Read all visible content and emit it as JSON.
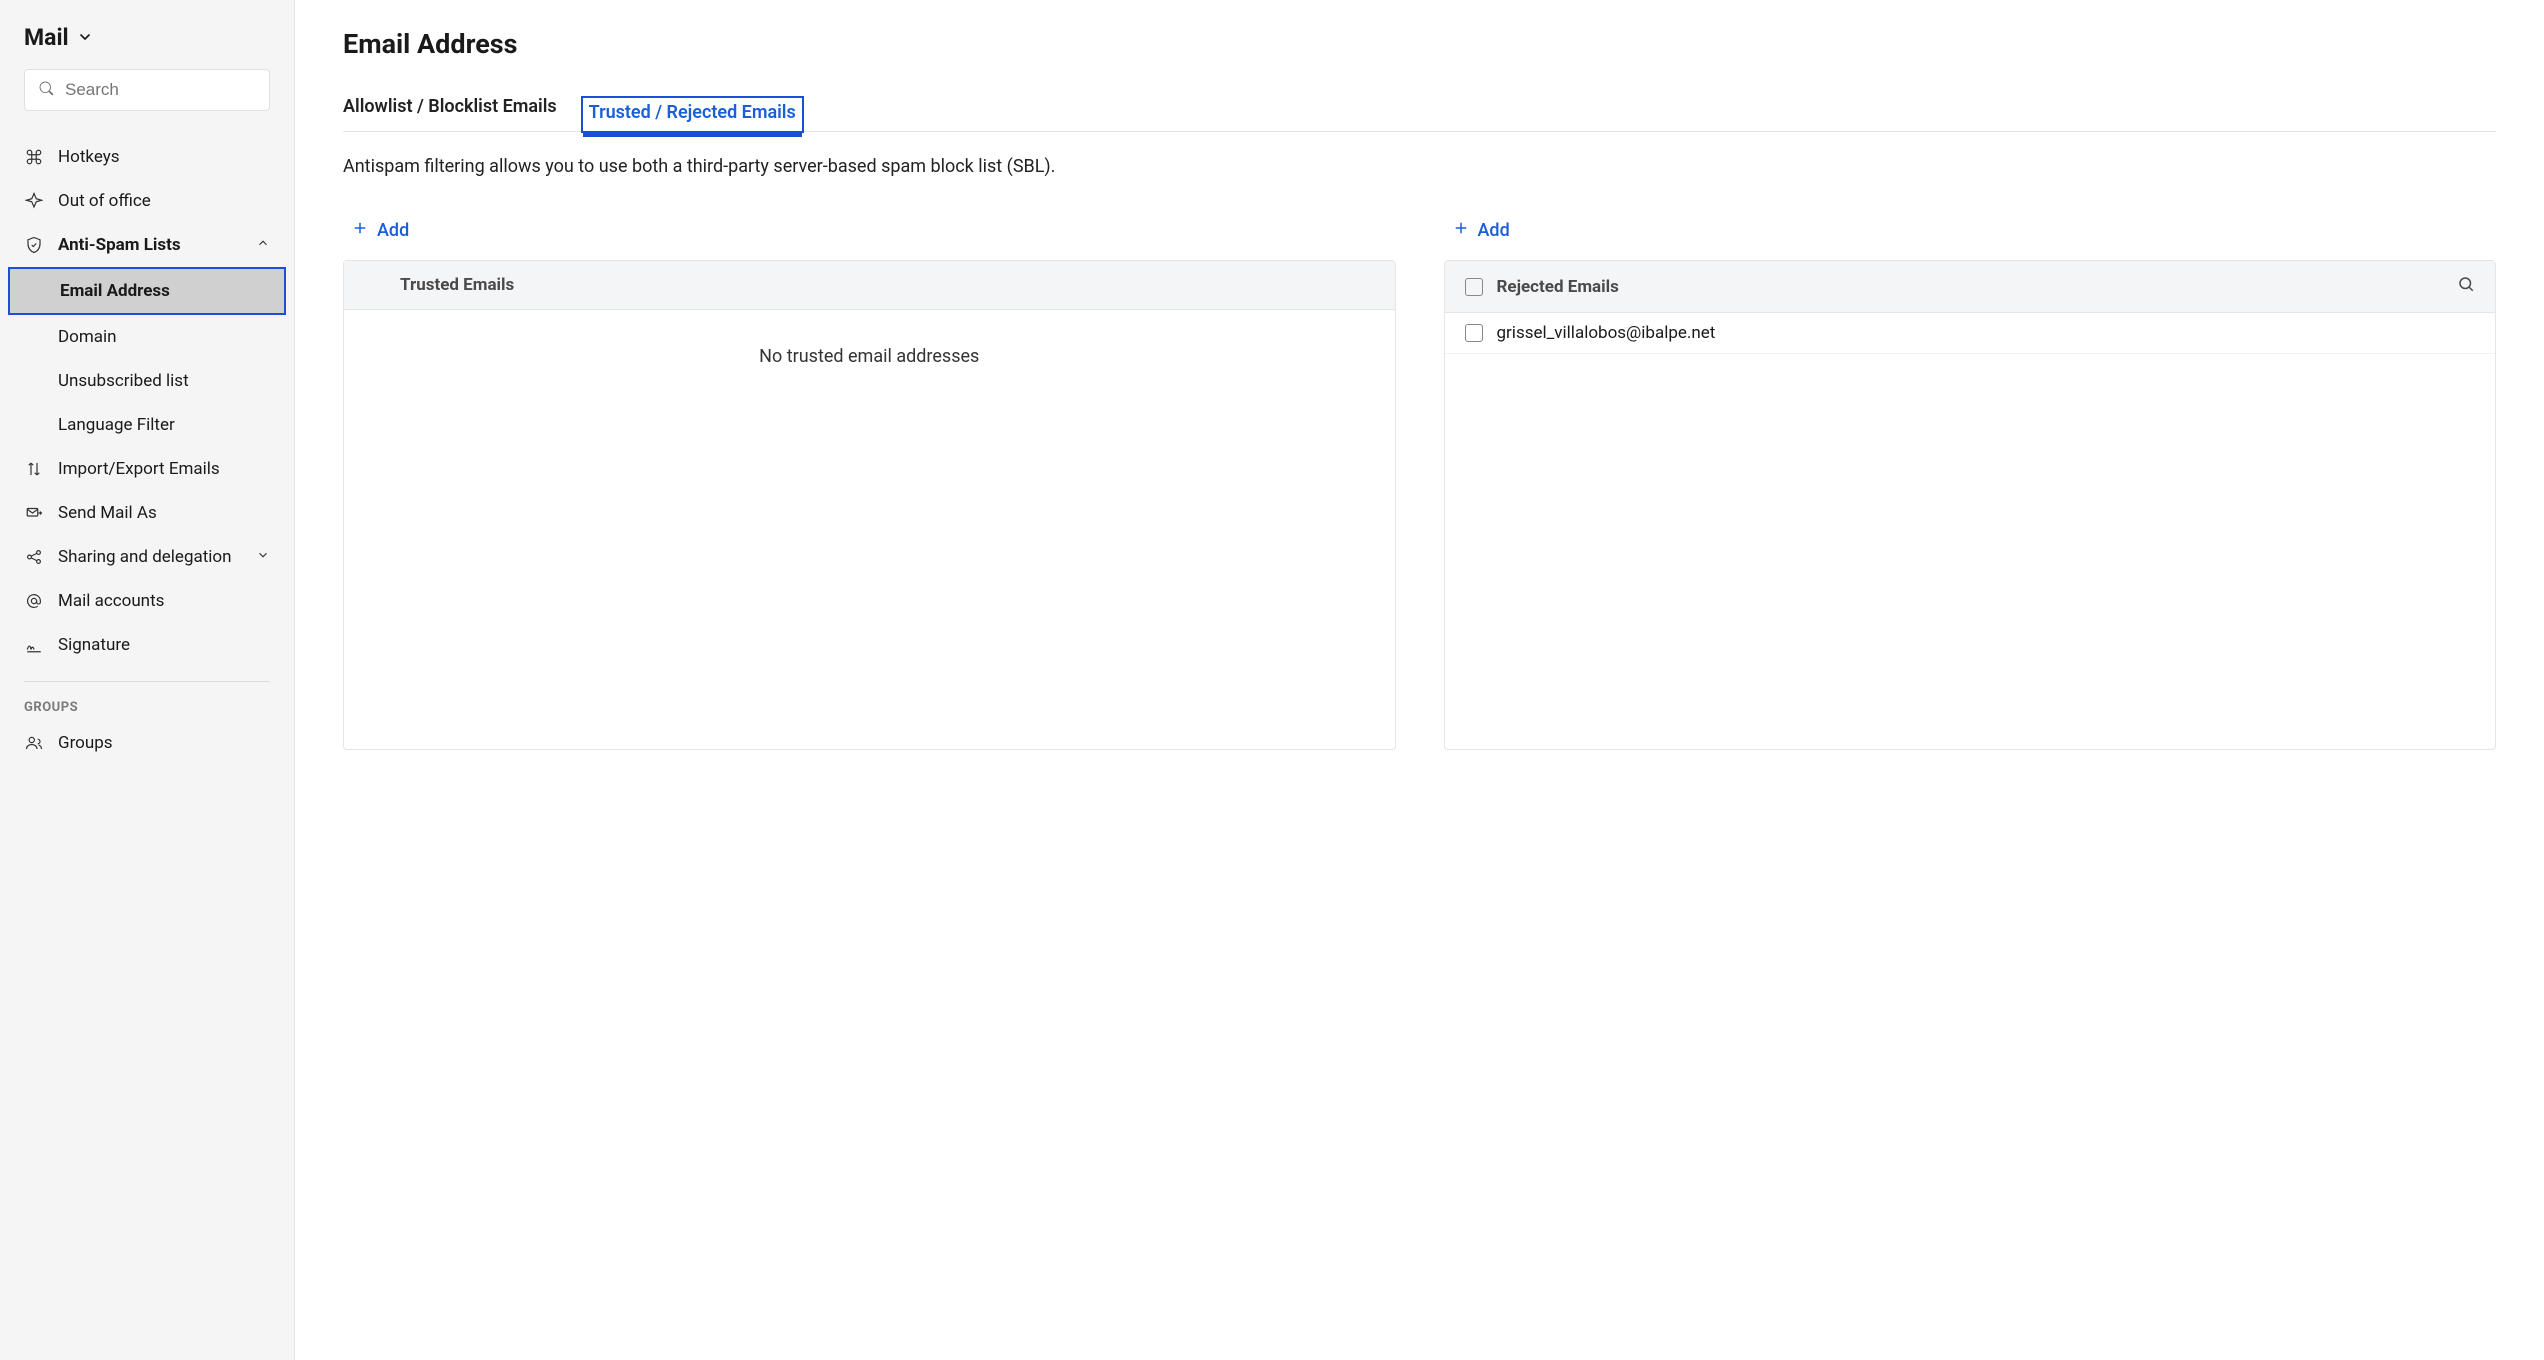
{
  "sidebar": {
    "header_label": "Mail",
    "search_placeholder": "Search",
    "items": {
      "hotkeys": "Hotkeys",
      "out_of_office": "Out of office",
      "anti_spam": "Anti-Spam Lists",
      "import_export": "Import/Export Emails",
      "send_mail_as": "Send Mail As",
      "sharing": "Sharing and delegation",
      "mail_accounts": "Mail accounts",
      "signature": "Signature",
      "groups": "Groups"
    },
    "anti_spam_sub": {
      "email_address": "Email Address",
      "domain": "Domain",
      "unsubscribed": "Unsubscribed list",
      "language_filter": "Language Filter"
    },
    "groups_section": "GROUPS"
  },
  "main": {
    "page_title": "Email Address",
    "tabs": {
      "allowlist": "Allowlist / Blocklist Emails",
      "trusted": "Trusted / Rejected Emails"
    },
    "description": "Antispam filtering allows you to use both a third-party server-based spam block list (SBL).",
    "add_label": "Add",
    "trusted": {
      "header": "Trusted Emails",
      "empty": "No trusted email addresses"
    },
    "rejected": {
      "header": "Rejected Emails",
      "items": [
        "grissel_villalobos@ibalpe.net"
      ]
    }
  }
}
